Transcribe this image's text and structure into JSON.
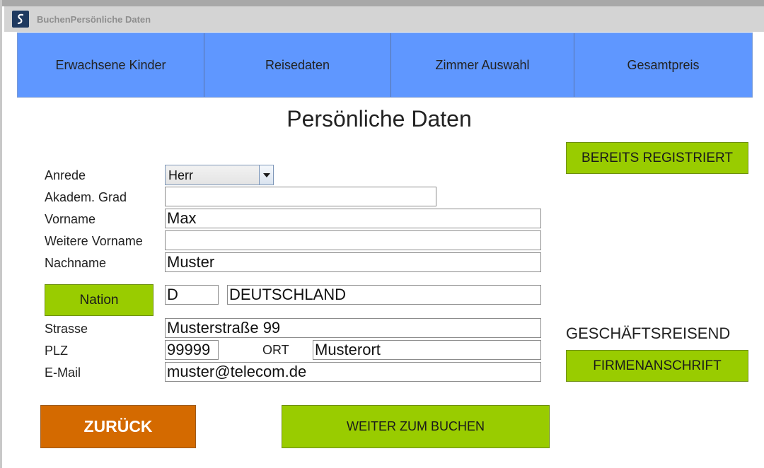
{
  "window": {
    "title": "BuchenPersönliche Daten"
  },
  "tabs": [
    {
      "label": "Erwachsene Kinder"
    },
    {
      "label": "Reisedaten"
    },
    {
      "label": "Zimmer Auswahl"
    },
    {
      "label": "Gesamtpreis"
    }
  ],
  "page": {
    "title": "Persönliche Daten"
  },
  "form": {
    "anrede": {
      "label": "Anrede",
      "value": "Herr"
    },
    "grad": {
      "label": "Akadem. Grad",
      "value": ""
    },
    "vorname": {
      "label": "Vorname",
      "value": "Max"
    },
    "weitere_vorname": {
      "label": "Weitere Vorname",
      "value": ""
    },
    "nachname": {
      "label": "Nachname",
      "value": "Muster"
    },
    "nation": {
      "button_label": "Nation",
      "code": "D",
      "name": "DEUTSCHLAND"
    },
    "strasse": {
      "label": "Strasse",
      "value": "Musterstraße 99"
    },
    "plz": {
      "label": "PLZ",
      "value": "99999"
    },
    "ort": {
      "label": "ORT",
      "value": "Musterort"
    },
    "email": {
      "label": "E-Mail",
      "value": "muster@telecom.de"
    }
  },
  "side": {
    "registered_button": "BEREITS REGISTRIERT",
    "business_label": "GESCHÄFTSREISEND",
    "company_button": "FIRMENANSCHRIFT"
  },
  "actions": {
    "back_button": "ZURÜCK",
    "next_button": "WEITER ZUM BUCHEN"
  },
  "colors": {
    "tab_blue": "#5f97ff",
    "accent_green": "#99cc00",
    "back_orange": "#d46a00",
    "app_icon_navy": "#1f3a60"
  },
  "icons": {
    "app": "app-logo-icon",
    "dropdown": "chevron-down-icon"
  }
}
